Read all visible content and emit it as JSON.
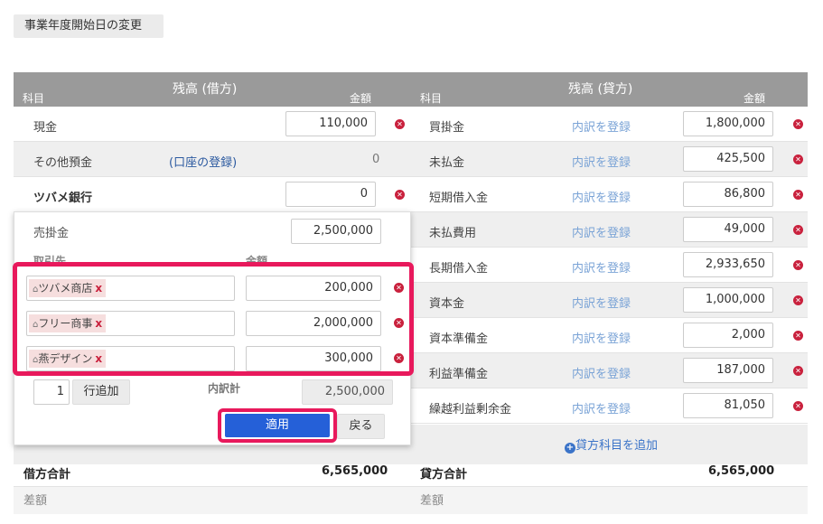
{
  "top_button": "事業年度開始日の変更",
  "debit": {
    "title": "残高 (借方)",
    "col_item": "科目",
    "col_amount": "金額",
    "rows": [
      {
        "name": "現金",
        "amount": "110,000"
      },
      {
        "name": "その他預金",
        "link": "(口座の登録)",
        "amount": "0"
      },
      {
        "name": "ツバメ銀行",
        "amount": "0"
      }
    ],
    "total_label": "借方合計",
    "total": "6,565,000",
    "diff_label": "差額"
  },
  "credit": {
    "title": "残高 (貸方)",
    "col_item": "科目",
    "col_amount": "金額",
    "register_label": "内訳を登録",
    "rows": [
      {
        "name": "買掛金",
        "amount": "1,800,000"
      },
      {
        "name": "未払金",
        "amount": "425,500"
      },
      {
        "name": "短期借入金",
        "amount": "86,800"
      },
      {
        "name": "未払費用",
        "amount": "49,000"
      },
      {
        "name": "長期借入金",
        "amount": "2,933,650"
      },
      {
        "name": "資本金",
        "amount": "1,000,000"
      },
      {
        "name": "資本準備金",
        "amount": "2,000"
      },
      {
        "name": "利益準備金",
        "amount": "187,000"
      },
      {
        "name": "繰越利益剰余金",
        "amount": "81,050"
      }
    ],
    "add_link": "貸方科目を追加",
    "total_label": "貸方合計",
    "total": "6,565,000",
    "diff_label": "差額"
  },
  "popup": {
    "account": "売掛金",
    "account_amount": "2,500,000",
    "col_partner": "取引先",
    "col_amount": "金額",
    "rows": [
      {
        "partner": "ツバメ商店",
        "amount": "200,000"
      },
      {
        "partner": "フリー商事",
        "amount": "2,000,000"
      },
      {
        "partner": "燕デザイン",
        "amount": "300,000"
      }
    ],
    "row_count": "1",
    "add_row_label": "行追加",
    "subtotal_label": "内訳計",
    "subtotal": "2,500,000",
    "apply_label": "適用",
    "back_label": "戻る"
  },
  "colors": {
    "header": "#9a9a9a",
    "accent": "#e8195c",
    "primary": "#2560d8",
    "delete": "#c9213d",
    "link": "#7aa3d6"
  },
  "icons": [
    "delete-icon",
    "home-icon",
    "plus-circle-icon"
  ]
}
